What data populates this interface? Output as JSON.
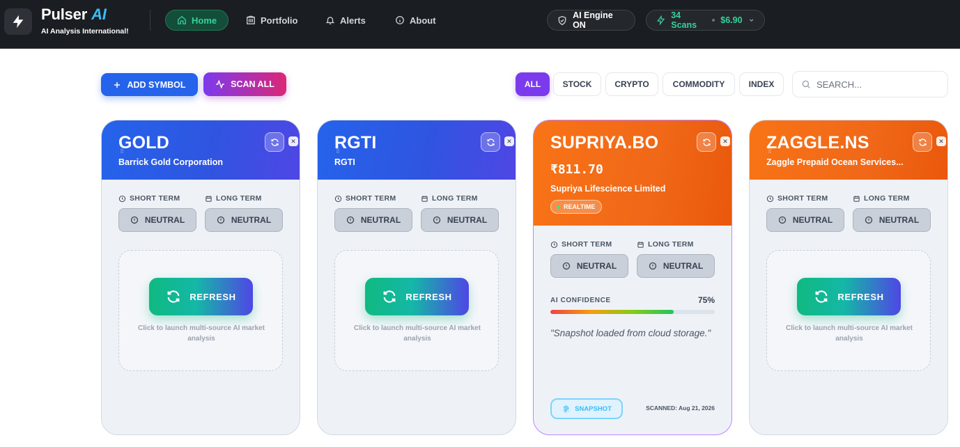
{
  "app": {
    "name": "Pulser",
    "name_accent": "AI",
    "tagline": "AI Analysis International!",
    "logo_icon": "bolt-icon"
  },
  "nav": {
    "items": [
      {
        "label": "Home",
        "icon": "home-icon",
        "active": true
      },
      {
        "label": "Portfolio",
        "icon": "building-icon",
        "active": false
      },
      {
        "label": "Alerts",
        "icon": "bell-icon",
        "active": false
      },
      {
        "label": "About",
        "icon": "info-icon",
        "active": false
      }
    ],
    "engine_status": "AI Engine ON",
    "scans": "34 Scans",
    "balance": "$6.90"
  },
  "toolbar": {
    "add_label": "ADD SYMBOL",
    "scan_label": "SCAN ALL",
    "filters": [
      "ALL",
      "STOCK",
      "CRYPTO",
      "COMMODITY",
      "INDEX"
    ],
    "active_filter": "ALL",
    "search_placeholder": "SEARCH..."
  },
  "labels": {
    "short_term": "SHORT TERM",
    "long_term": "LONG TERM",
    "refresh": "REFRESH",
    "hint": "Click to launch multi-source AI market analysis",
    "ai_confidence": "AI CONFIDENCE",
    "realtime": "REALTIME",
    "snapshot": "SNAPSHOT"
  },
  "cards": [
    {
      "symbol": "GOLD",
      "company": "Barrick Gold Corporation",
      "short_term": "NEUTRAL",
      "long_term": "NEUTRAL",
      "theme": "blue"
    },
    {
      "symbol": "RGTI",
      "company": "RGTI",
      "short_term": "NEUTRAL",
      "long_term": "NEUTRAL",
      "theme": "blue"
    },
    {
      "symbol": "SUPRIYA.BO",
      "price": "₹811.70",
      "company": "Supriya Lifescience Limited",
      "short_term": "NEUTRAL",
      "long_term": "NEUTRAL",
      "confidence": "75%",
      "confidence_value": 0.75,
      "quote": "\"Snapshot loaded from cloud storage.\"",
      "scanned": "SCANNED: Aug 21, 2026",
      "theme": "orange"
    },
    {
      "symbol": "ZAGGLE.NS",
      "company": "Zaggle Prepaid Ocean Services...",
      "short_term": "NEUTRAL",
      "long_term": "NEUTRAL",
      "theme": "orange"
    }
  ],
  "colors": {
    "accent_purple": "#7c3aed",
    "primary_blue": "#2563eb",
    "orange": "#f97316",
    "green": "#10b981"
  }
}
